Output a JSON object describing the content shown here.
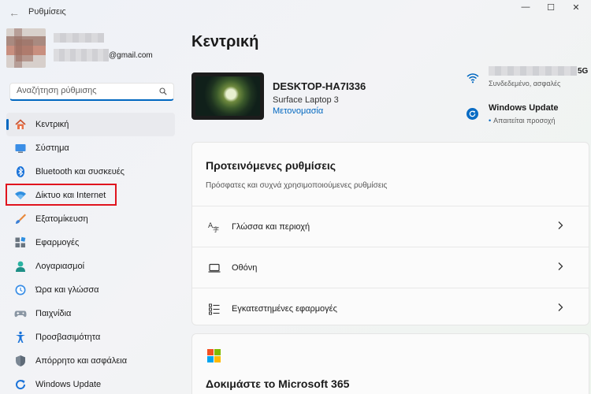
{
  "window": {
    "title": "Ρυθμίσεις",
    "back_glyph": "←",
    "minimize_glyph": "—",
    "maximize_glyph": "☐",
    "close_glyph": "✕"
  },
  "account": {
    "email_suffix": "@gmail.com"
  },
  "search": {
    "placeholder": "Αναζήτηση ρύθμισης"
  },
  "sidebar": {
    "items": [
      {
        "label": "Κεντρική",
        "icon": "home-icon",
        "active": true
      },
      {
        "label": "Σύστημα",
        "icon": "system-icon"
      },
      {
        "label": "Bluetooth και συσκευές",
        "icon": "bluetooth-icon"
      },
      {
        "label": "Δίκτυο και Internet",
        "icon": "network-icon"
      },
      {
        "label": "Εξατομίκευση",
        "icon": "brush-icon"
      },
      {
        "label": "Εφαρμογές",
        "icon": "apps-icon"
      },
      {
        "label": "Λογαριασμοί",
        "icon": "accounts-icon"
      },
      {
        "label": "Ώρα και γλώσσα",
        "icon": "time-language-icon"
      },
      {
        "label": "Παιχνίδια",
        "icon": "gaming-icon"
      },
      {
        "label": "Προσβασιμότητα",
        "icon": "accessibility-icon"
      },
      {
        "label": "Απόρρητο και ασφάλεια",
        "icon": "shield-icon"
      },
      {
        "label": "Windows Update",
        "icon": "windows-update-icon"
      }
    ]
  },
  "main": {
    "title": "Κεντρική",
    "device": {
      "name": "DESKTOP-HA7I336",
      "model": "Surface Laptop 3",
      "rename_link": "Μετονομασία"
    },
    "status": {
      "wifi_suffix": "5G",
      "wifi_state": "Συνδεδεμένο, ασφαλές",
      "update_title": "Windows Update",
      "update_state": "Απαιτείται προσοχή",
      "update_dot": "•"
    },
    "recommended": {
      "title": "Προτεινόμενες ρυθμίσεις",
      "subtitle": "Πρόσφατες και συχνά χρησιμοποιούμενες ρυθμίσεις",
      "rows": [
        {
          "label": "Γλώσσα και περιοχή",
          "icon": "language-region-icon"
        },
        {
          "label": "Οθόνη",
          "icon": "display-icon"
        },
        {
          "label": "Εγκατεστημένες εφαρμογές",
          "icon": "installed-apps-icon"
        }
      ]
    },
    "m365": {
      "title": "Δοκιμάστε το Microsoft 365"
    }
  },
  "colors": {
    "accent": "#0067c0",
    "highlight": "#e0141e"
  }
}
